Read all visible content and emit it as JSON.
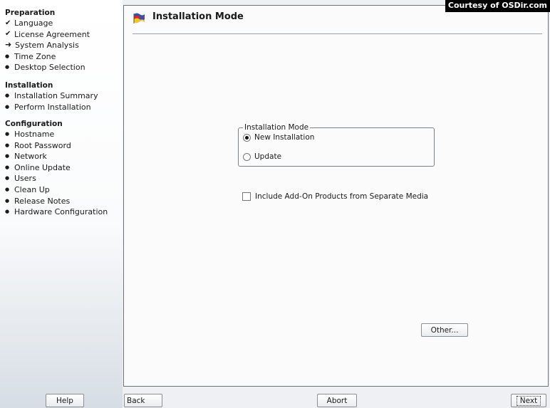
{
  "watermark": "Courtesy of OSDir.com",
  "sidebar": {
    "sections": [
      {
        "title": "Preparation",
        "steps": [
          {
            "label": "Language",
            "state": "done"
          },
          {
            "label": "License Agreement",
            "state": "done"
          },
          {
            "label": "System Analysis",
            "state": "current"
          },
          {
            "label": "Time Zone",
            "state": "todo"
          },
          {
            "label": "Desktop Selection",
            "state": "todo"
          }
        ]
      },
      {
        "title": "Installation",
        "steps": [
          {
            "label": "Installation Summary",
            "state": "todo"
          },
          {
            "label": "Perform Installation",
            "state": "todo"
          }
        ]
      },
      {
        "title": "Configuration",
        "steps": [
          {
            "label": "Hostname",
            "state": "todo"
          },
          {
            "label": "Root Password",
            "state": "todo"
          },
          {
            "label": "Network",
            "state": "todo"
          },
          {
            "label": "Online Update",
            "state": "todo"
          },
          {
            "label": "Users",
            "state": "todo"
          },
          {
            "label": "Clean Up",
            "state": "todo"
          },
          {
            "label": "Release Notes",
            "state": "todo"
          },
          {
            "label": "Hardware Configuration",
            "state": "todo"
          }
        ]
      }
    ]
  },
  "dialog": {
    "title": "Installation Mode",
    "title_icon": "installation-flag-icon",
    "mode_group": {
      "legend": "Installation Mode",
      "options": [
        {
          "label": "New Installation",
          "checked": true
        },
        {
          "label": "Update",
          "checked": false
        }
      ]
    },
    "addon_checkbox": {
      "label": "Include Add-On Products from Separate Media",
      "checked": false
    },
    "other_button": "Other..."
  },
  "footer": {
    "help": "Help",
    "back": "Back",
    "abort": "Abort",
    "next": "Next"
  }
}
